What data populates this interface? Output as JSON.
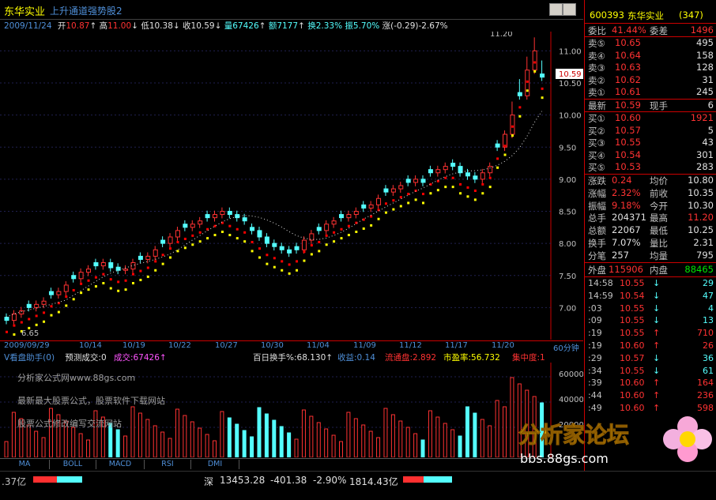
{
  "title": {
    "stock_name": "东华实业",
    "formula_name": "上升通道强势股2"
  },
  "quote_line": {
    "date": "2009/11/24",
    "open_label": "开",
    "open": "10.87",
    "high_label": "高",
    "high": "11.00",
    "low_label": "低",
    "low": "10.38",
    "close_label": "收",
    "close": "10.59",
    "vol_label": "量",
    "vol": "67426",
    "amt_label": "额",
    "amt": "7177",
    "turn_label": "换",
    "turn": "2.33%",
    "amp_label": "振",
    "amp": "5.70%",
    "chg_label": "涨",
    "chg": "(-0.29)-2.67%"
  },
  "price_axis": [
    "11.00",
    "10.50",
    "10.00",
    "9.50",
    "9.00",
    "8.50",
    "8.00",
    "7.50",
    "7.00"
  ],
  "annotations": {
    "high_mark": "11.20",
    "low_mark": "6.65",
    "current_price": "10.59"
  },
  "date_axis": {
    "labels": [
      "2009/09/29",
      "10/14",
      "10/19",
      "10/22",
      "10/27",
      "10/30",
      "11/04",
      "11/09",
      "11/12",
      "11/17",
      "11/20"
    ],
    "period": "60分钟"
  },
  "vol_header": {
    "title": "V看盘助手(0)",
    "predict_label": "预测成交:0",
    "vol_label": "成交:67426↑",
    "turnover_label": "百日换手%:68.130↑",
    "profit_label": "收益:0.14",
    "float_label": "流通盘:2.892",
    "pe_label": "市盈率:56.732",
    "conc_label": "集中度:1"
  },
  "vol_axis": [
    "60000",
    "40000",
    "20000"
  ],
  "ads": [
    "分析家公式网www.88gs.com",
    "最新最大股票公式，股票软件下载网站",
    "股票公式修改编写交流网站"
  ],
  "bottom_tabs": [
    "MA",
    "BOLL",
    "MACD",
    "RSI",
    "DMI"
  ],
  "status_bar": {
    "left_fragment": ".37亿",
    "index_name": "深",
    "index_value": "13453.28",
    "index_change": "-401.38",
    "index_pct": "-2.90%",
    "index_amount": "1814.43亿"
  },
  "right_panel": {
    "code": "600393",
    "name": "东华实业",
    "rank": "(347)",
    "weibi_label": "委比",
    "weibi": "41.44%",
    "weicha_label": "委差",
    "weicha": "1496",
    "asks": [
      {
        "label": "卖⑤",
        "price": "10.65",
        "vol": "495"
      },
      {
        "label": "卖④",
        "price": "10.64",
        "vol": "158"
      },
      {
        "label": "卖③",
        "price": "10.63",
        "vol": "128"
      },
      {
        "label": "卖②",
        "price": "10.62",
        "vol": "31"
      },
      {
        "label": "卖①",
        "price": "10.61",
        "vol": "245"
      }
    ],
    "last_label": "最新",
    "last": "10.59",
    "hand_label": "现手",
    "hand": "6",
    "bids": [
      {
        "label": "买①",
        "price": "10.60",
        "vol": "1921"
      },
      {
        "label": "买②",
        "price": "10.57",
        "vol": "5"
      },
      {
        "label": "买③",
        "price": "10.55",
        "vol": "43"
      },
      {
        "label": "买④",
        "price": "10.54",
        "vol": "301"
      },
      {
        "label": "买⑤",
        "price": "10.53",
        "vol": "283"
      }
    ],
    "stats": [
      {
        "l1": "涨跌",
        "v1": "0.24",
        "l2": "均价",
        "v2": "10.80"
      },
      {
        "l1": "涨幅",
        "v1": "2.32%",
        "l2": "前收",
        "v2": "10.35"
      },
      {
        "l1": "振幅",
        "v1": "9.18%",
        "l2": "今开",
        "v2": "10.30"
      },
      {
        "l1": "总手",
        "v1": "204371",
        "l2": "最高",
        "v2": "11.20"
      },
      {
        "l1": "总额",
        "v1": "22067",
        "l2": "最低",
        "v2": "10.25"
      },
      {
        "l1": "换手",
        "v1": "7.07%",
        "l2": "量比",
        "v2": "2.31"
      },
      {
        "l1": "分笔",
        "v1": "257",
        "l2": "均量",
        "v2": "795"
      }
    ],
    "outer_label": "外盘",
    "outer": "115906",
    "inner_label": "内盘",
    "inner": "88465",
    "ticks": [
      {
        "time": "14:58",
        "price": "10.55",
        "dir": "↓",
        "vol": "29"
      },
      {
        "time": "14:59",
        "price": "10.54",
        "dir": "↓",
        "vol": "47"
      },
      {
        "time": ":03",
        "price": "10.55",
        "dir": "↓",
        "vol": "4"
      },
      {
        "time": ":09",
        "price": "10.55",
        "dir": "↓",
        "vol": "13"
      },
      {
        "time": ":19",
        "price": "10.55",
        "dir": "↑",
        "vol": "710"
      },
      {
        "time": ":19",
        "price": "10.60",
        "dir": "↑",
        "vol": "26"
      },
      {
        "time": ":29",
        "price": "10.57",
        "dir": "↓",
        "vol": "36"
      },
      {
        "time": ":34",
        "price": "10.55",
        "dir": "↓",
        "vol": "61"
      },
      {
        "time": ":39",
        "price": "10.60",
        "dir": "↑",
        "vol": "164"
      },
      {
        "time": ":44",
        "price": "10.60",
        "dir": "↑",
        "vol": "236"
      },
      {
        "time": ":49",
        "price": "10.60",
        "dir": "↑",
        "vol": "598"
      }
    ]
  },
  "watermark": {
    "text": "分析家论坛",
    "url": "bbs.88gs.com"
  },
  "chart_data": {
    "type": "candlestick",
    "y_range": [
      6.5,
      11.3
    ],
    "note_points": {
      "high": 11.2,
      "low": 6.65
    },
    "closes": [
      6.8,
      6.9,
      6.95,
      7.0,
      7.05,
      7.1,
      7.2,
      7.25,
      7.35,
      7.45,
      7.55,
      7.6,
      7.65,
      7.7,
      7.62,
      7.58,
      7.6,
      7.7,
      7.75,
      7.8,
      7.9,
      8.0,
      8.1,
      8.2,
      8.25,
      8.3,
      8.35,
      8.4,
      8.45,
      8.5,
      8.45,
      8.4,
      8.35,
      8.2,
      8.1,
      8.0,
      7.95,
      7.9,
      7.85,
      7.9,
      8.05,
      8.15,
      8.2,
      8.3,
      8.35,
      8.4,
      8.45,
      8.5,
      8.55,
      8.6,
      8.7,
      8.8,
      8.85,
      8.9,
      8.95,
      9.0,
      8.95,
      9.1,
      9.15,
      9.2,
      9.2,
      9.1,
      9.05,
      9.0,
      9.1,
      9.2,
      9.5,
      9.7,
      10.0,
      10.3,
      10.7,
      11.0,
      10.59
    ]
  }
}
